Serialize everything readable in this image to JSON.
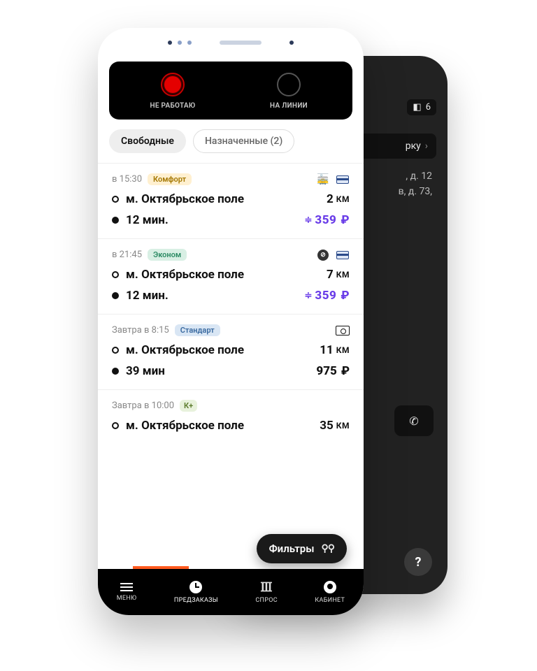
{
  "back_phone": {
    "corner_badge_count": "6",
    "button_label_partial": "рку",
    "address_line1_partial": ", д. 12",
    "address_line2_partial": "в, д. 73,"
  },
  "status_toggle": {
    "off_label": "НЕ РАБОТАЮ",
    "on_label": "НА ЛИНИИ"
  },
  "tabs": {
    "free": "Свободные",
    "assigned": "Назначенные (2)"
  },
  "orders": [
    {
      "time": "в 15:30",
      "tariff_label": "Комфорт",
      "tariff_class": "tariff-comfort",
      "icons": [
        "tram",
        "card"
      ],
      "address": "м. Октябрьское поле",
      "distance": "2",
      "duration": "12 мин.",
      "price": "359",
      "surge": true
    },
    {
      "time": "в 21:45",
      "tariff_label": "Эконом",
      "tariff_class": "tariff-econom",
      "icons": [
        "nosmoke",
        "card"
      ],
      "address": "м. Октябрьское поле",
      "distance": "7",
      "duration": "12 мин.",
      "price": "359",
      "surge": true
    },
    {
      "time": "Завтра в 8:15",
      "tariff_label": "Стандарт",
      "tariff_class": "tariff-standard",
      "icons": [
        "cash"
      ],
      "address": "м. Октябрьское поле",
      "distance": "11",
      "duration": "39 мин",
      "price": "975",
      "surge": false
    },
    {
      "time": "Завтра в 10:00",
      "tariff_label": "К+",
      "tariff_class": "tariff-kplus",
      "icons": [],
      "address": "м. Октябрьское поле",
      "distance": "35",
      "duration": "",
      "price": "",
      "surge": false
    }
  ],
  "filters_label": "Фильтры",
  "km_unit": "КМ",
  "ruble": "₽",
  "nav": {
    "menu": "МЕНЮ",
    "preorders": "ПРЕДЗАКАЗЫ",
    "demand": "СПРОС",
    "cabinet": "КАБИНЕТ"
  },
  "help_symbol": "?"
}
